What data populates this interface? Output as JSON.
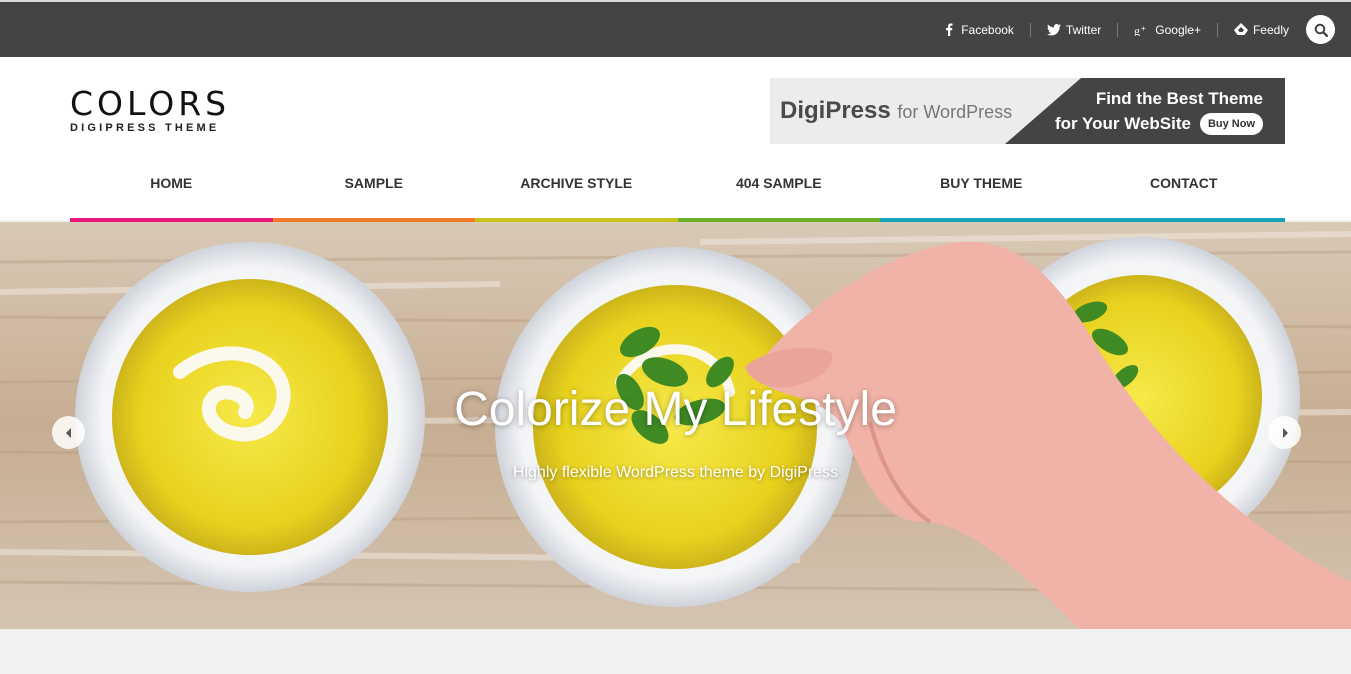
{
  "topbar": {
    "social": [
      {
        "label": "Facebook",
        "icon": "facebook-icon"
      },
      {
        "label": "Twitter",
        "icon": "twitter-icon"
      },
      {
        "label": "Google+",
        "icon": "google-plus-icon"
      },
      {
        "label": "Feedly",
        "icon": "feedly-icon"
      }
    ],
    "search_icon": "search-icon"
  },
  "header": {
    "logo_title": "COLORS",
    "logo_subtitle": "DIGIPRESS THEME",
    "banner": {
      "brand": "DigiPress",
      "for_text": "for WordPress",
      "line1": "Find the Best Theme",
      "line2": "for Your WebSite",
      "button": "Buy Now"
    }
  },
  "nav": {
    "items": [
      {
        "label": "HOME",
        "color": "#e8197a"
      },
      {
        "label": "SAMPLE",
        "color": "#ee7a2a"
      },
      {
        "label": "ARCHIVE STYLE",
        "color": "#c8c21b"
      },
      {
        "label": "404 SAMPLE",
        "color": "#6cb125"
      },
      {
        "label": "BUY THEME",
        "color": "#12a3b8"
      },
      {
        "label": "CONTACT",
        "color": "#12a3b8"
      }
    ]
  },
  "slider": {
    "title": "Colorize My Lifestyle",
    "subtitle": "Highly flexible WordPress theme by DigiPress",
    "prev_icon": "chevron-left-icon",
    "next_icon": "chevron-right-icon"
  }
}
